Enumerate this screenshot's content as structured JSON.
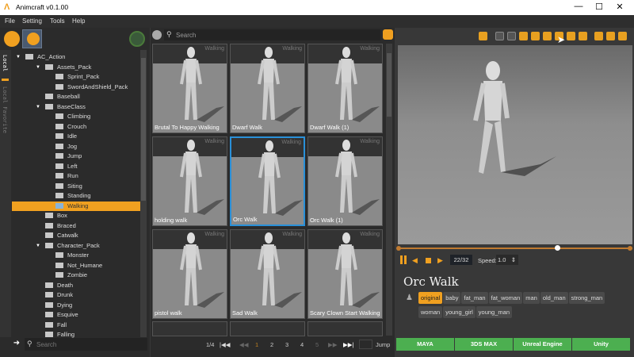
{
  "window": {
    "title": "Animcraft v0.1.00",
    "min": "—",
    "max": "☐",
    "close": "✕"
  },
  "menu": [
    "File",
    "Setting",
    "Tools",
    "Help"
  ],
  "side_tabs": [
    "Local",
    "Local Favorite"
  ],
  "tree": [
    {
      "label": "AC_Action",
      "level": 0,
      "expanded": true,
      "icon": "home-icon"
    },
    {
      "label": "Assets_Pack",
      "level": 1,
      "expanded": true
    },
    {
      "label": "Sprint_Pack",
      "level": 2
    },
    {
      "label": "SwordAndShield_Pack",
      "level": 2
    },
    {
      "label": "Baseball",
      "level": 1
    },
    {
      "label": "BaseClass",
      "level": 1,
      "expanded": true
    },
    {
      "label": "Climbing",
      "level": 2
    },
    {
      "label": "Crouch",
      "level": 2
    },
    {
      "label": "Idle",
      "level": 2
    },
    {
      "label": "Jog",
      "level": 2
    },
    {
      "label": "Jump",
      "level": 2
    },
    {
      "label": "Left",
      "level": 2
    },
    {
      "label": "Run",
      "level": 2
    },
    {
      "label": "Siting",
      "level": 2
    },
    {
      "label": "Standing",
      "level": 2
    },
    {
      "label": "Walking",
      "level": 2,
      "selected": true
    },
    {
      "label": "Box",
      "level": 1
    },
    {
      "label": "Braced",
      "level": 1
    },
    {
      "label": "Catwalk",
      "level": 1
    },
    {
      "label": "Character_Pack",
      "level": 1,
      "expanded": true
    },
    {
      "label": "Monster",
      "level": 2
    },
    {
      "label": "Not_Humane",
      "level": 2
    },
    {
      "label": "Zombie",
      "level": 2
    },
    {
      "label": "Death",
      "level": 1
    },
    {
      "label": "Drunk",
      "level": 1
    },
    {
      "label": "Dying",
      "level": 1
    },
    {
      "label": "Esquive",
      "level": 1
    },
    {
      "label": "Fall",
      "level": 1
    },
    {
      "label": "Falling",
      "level": 1
    }
  ],
  "tree_search": {
    "placeholder": "Search"
  },
  "grid_search": {
    "placeholder": "Search"
  },
  "thumbnails": [
    {
      "name": "Brutal To Happy Walking",
      "category": "Walking"
    },
    {
      "name": "Dwarf Walk",
      "category": "Walking"
    },
    {
      "name": "Dwarf Walk (1)",
      "category": "Walking"
    },
    {
      "name": "holding walk",
      "category": "Walking"
    },
    {
      "name": "Orc Walk",
      "category": "Walking",
      "selected": true
    },
    {
      "name": "Orc Walk (1)",
      "category": "Walking"
    },
    {
      "name": "pistol walk",
      "category": "Walking"
    },
    {
      "name": "Sad Walk",
      "category": "Walking"
    },
    {
      "name": "Scary Clown Start Walking",
      "category": "Walking"
    }
  ],
  "pagination": {
    "page_info": "1/4",
    "pages": [
      "1",
      "2",
      "3",
      "4",
      "5"
    ],
    "current": "1",
    "first": "|◀◀",
    "prev": "◀◀",
    "next": "▶▶",
    "last": "▶▶|",
    "jump_label": "Jump",
    "jump_value": ""
  },
  "player": {
    "frame": "22/32",
    "speed_label": "Speed:",
    "speed": "1.0",
    "progress": 0.6875
  },
  "animation": {
    "title": "Orc Walk",
    "tags": [
      "original",
      "baby",
      "fat_man",
      "fat_woman",
      "man",
      "old_man",
      "strong_man",
      "woman",
      "young_girl",
      "young_man"
    ],
    "active_tag": "original"
  },
  "export": [
    "MAYA",
    "3DS MAX",
    "Unreal Engine",
    "Unity"
  ],
  "colors": {
    "accent": "#f0a020",
    "selection": "#2a90d8",
    "export": "#4caf50"
  }
}
